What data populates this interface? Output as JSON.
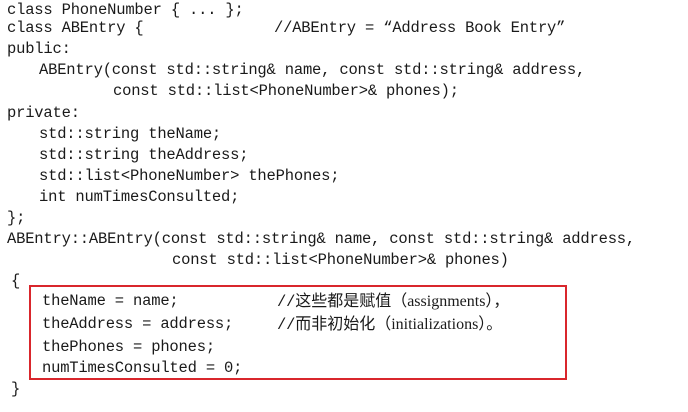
{
  "code": {
    "lines": {
      "l1": "class PhoneNumber { ... };",
      "l2_code": "class ABEntry {",
      "l2_comment": "//ABEntry = “Address Book Entry”",
      "l3": "public:",
      "l4": "ABEntry(const std::string& name, const std::string& address,",
      "l5": "const std::list<PhoneNumber>& phones);",
      "l6": "private:",
      "l7": "std::string theName;",
      "l8": "std::string theAddress;",
      "l9": "std::list<PhoneNumber> thePhones;",
      "l10": "int numTimesConsulted;",
      "l11": "};",
      "l12": "ABEntry::ABEntry(const std::string& name, const std::string& address,",
      "l13": "const std::list<PhoneNumber>& phones)",
      "l14": "{",
      "l15_code": "theName = name;",
      "l15_comment_prefix": "//",
      "l15_comment_text": "这些都是赋值（assignments），",
      "l16_code": "theAddress = address;",
      "l16_comment_prefix": "//",
      "l16_comment_text": "而非初始化（initializations）。",
      "l17": "thePhones = phones;",
      "l18": "numTimesConsulted = 0;",
      "l19": "}"
    }
  },
  "colors": {
    "highlight_border": "#d9262c",
    "text": "#1a1a1a"
  }
}
